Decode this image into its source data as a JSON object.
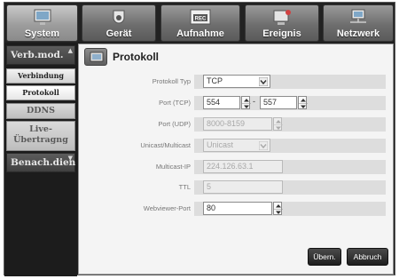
{
  "tabs": [
    {
      "label": "System",
      "icon": "monitor-icon",
      "active": true
    },
    {
      "label": "Gerät",
      "icon": "camera-icon",
      "active": false
    },
    {
      "label": "Aufnahme",
      "icon": "record-icon",
      "active": false
    },
    {
      "label": "Ereignis",
      "icon": "alarm-icon",
      "active": false
    },
    {
      "label": "Netzwerk",
      "icon": "network-icon",
      "active": false
    }
  ],
  "sidebar": {
    "verb_mod": "Verb.mod.",
    "verbindung": "Verbindung",
    "protokoll": "Protokoll",
    "ddns": "DDNS",
    "live_line1": "Live-",
    "live_line2": "Übertragng",
    "benach": "Benach.dien"
  },
  "page": {
    "title": "Protokoll"
  },
  "form": {
    "protokoll_typ": {
      "label": "Protokoll Typ",
      "value": "TCP"
    },
    "port_tcp": {
      "label": "Port (TCP)",
      "from": "554",
      "sep": "-",
      "to": "557"
    },
    "port_udp": {
      "label": "Port (UDP)",
      "value": "8000-8159"
    },
    "unicast": {
      "label": "Unicast/Multicast",
      "value": "Unicast"
    },
    "multicast_ip": {
      "label": "Multicast-IP",
      "value": "224.126.63.1"
    },
    "ttl": {
      "label": "TTL",
      "value": "5"
    },
    "webviewer_port": {
      "label": "Webviewer-Port",
      "value": "80"
    }
  },
  "buttons": {
    "apply": "Übern.",
    "cancel": "Abbruch"
  }
}
